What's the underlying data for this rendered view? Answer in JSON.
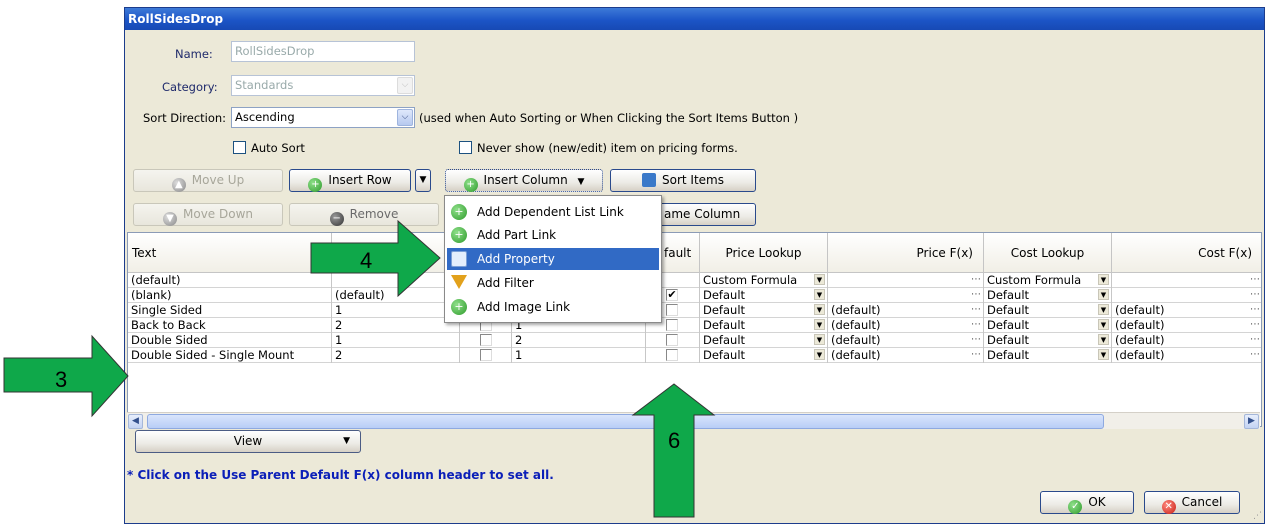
{
  "window": {
    "title": "RollSidesDrop"
  },
  "form": {
    "name_label": "Name:",
    "name_value": "RollSidesDrop",
    "category_label": "Category:",
    "category_value": "Standards",
    "sort_label": "Sort Direction:",
    "sort_value": "Ascending",
    "sort_note": "(used when Auto Sorting or When Clicking the Sort Items Button )",
    "auto_sort_label": "Auto Sort",
    "never_show_label": "Never show (new/edit) item on pricing forms."
  },
  "toolbar": {
    "move_up": "Move Up",
    "insert_row": "Insert Row",
    "insert_column": "Insert Column",
    "sort_items": "Sort Items",
    "move_down": "Move Down",
    "remove": "Remove",
    "rename_column_partial": "ame Column"
  },
  "menu": {
    "items": [
      {
        "label": "Add Dependent List Link",
        "icon": "plus-circle-icon"
      },
      {
        "label": "Add Part Link",
        "icon": "plus-circle-icon"
      },
      {
        "label": "Add Property",
        "icon": "property-icon"
      },
      {
        "label": "Add Filter",
        "icon": "funnel-icon"
      },
      {
        "label": "Add Image Link",
        "icon": "plus-circle-icon"
      }
    ],
    "selected_index": 2
  },
  "grid": {
    "headers": {
      "text": "Text",
      "default_partial": "fault",
      "price_lookup": "Price Lookup",
      "price_fx": "Price F(x)",
      "cost_lookup": "Cost Lookup",
      "cost_fx": "Cost F(x)"
    },
    "rows": [
      {
        "text": "(default)",
        "col2": "",
        "col4": "",
        "checked": false,
        "price_lookup": "Custom Formula",
        "price_fx": "",
        "cost_lookup": "Custom Formula",
        "cost_fx": ""
      },
      {
        "text": "(blank)",
        "col2": "(default)",
        "col4": "",
        "checked": true,
        "price_lookup": "Default",
        "price_fx": "",
        "cost_lookup": "Default",
        "cost_fx": ""
      },
      {
        "text": "Single Sided",
        "col2": "1",
        "col4": "",
        "checked": false,
        "price_lookup": "Default",
        "price_fx": "(default)",
        "cost_lookup": "Default",
        "cost_fx": "(default)"
      },
      {
        "text": "Back to Back",
        "col2": "2",
        "col4": "1",
        "checked": false,
        "price_lookup": "Default",
        "price_fx": "(default)",
        "cost_lookup": "Default",
        "cost_fx": "(default)"
      },
      {
        "text": "Double Sided",
        "col2": "1",
        "col4": "2",
        "checked": false,
        "price_lookup": "Default",
        "price_fx": "(default)",
        "cost_lookup": "Default",
        "cost_fx": "(default)"
      },
      {
        "text": "Double Sided - Single Mount",
        "col2": "2",
        "col4": "1",
        "checked": false,
        "price_lookup": "Default",
        "price_fx": "(default)",
        "cost_lookup": "Default",
        "cost_fx": "(default)"
      }
    ]
  },
  "view_button": "View",
  "footer_note": "* Click on the Use Parent Default F(x) column header to set all.",
  "ok_button": "OK",
  "cancel_button": "Cancel",
  "annotations": {
    "arrow3": "3",
    "arrow4": "4",
    "arrow6": "6",
    "arrow_color": "#0fa84a"
  },
  "colors": {
    "title_bar": "#1c55c7",
    "menu_highlight": "#316ac5",
    "note_text": "#0b1fb8"
  }
}
